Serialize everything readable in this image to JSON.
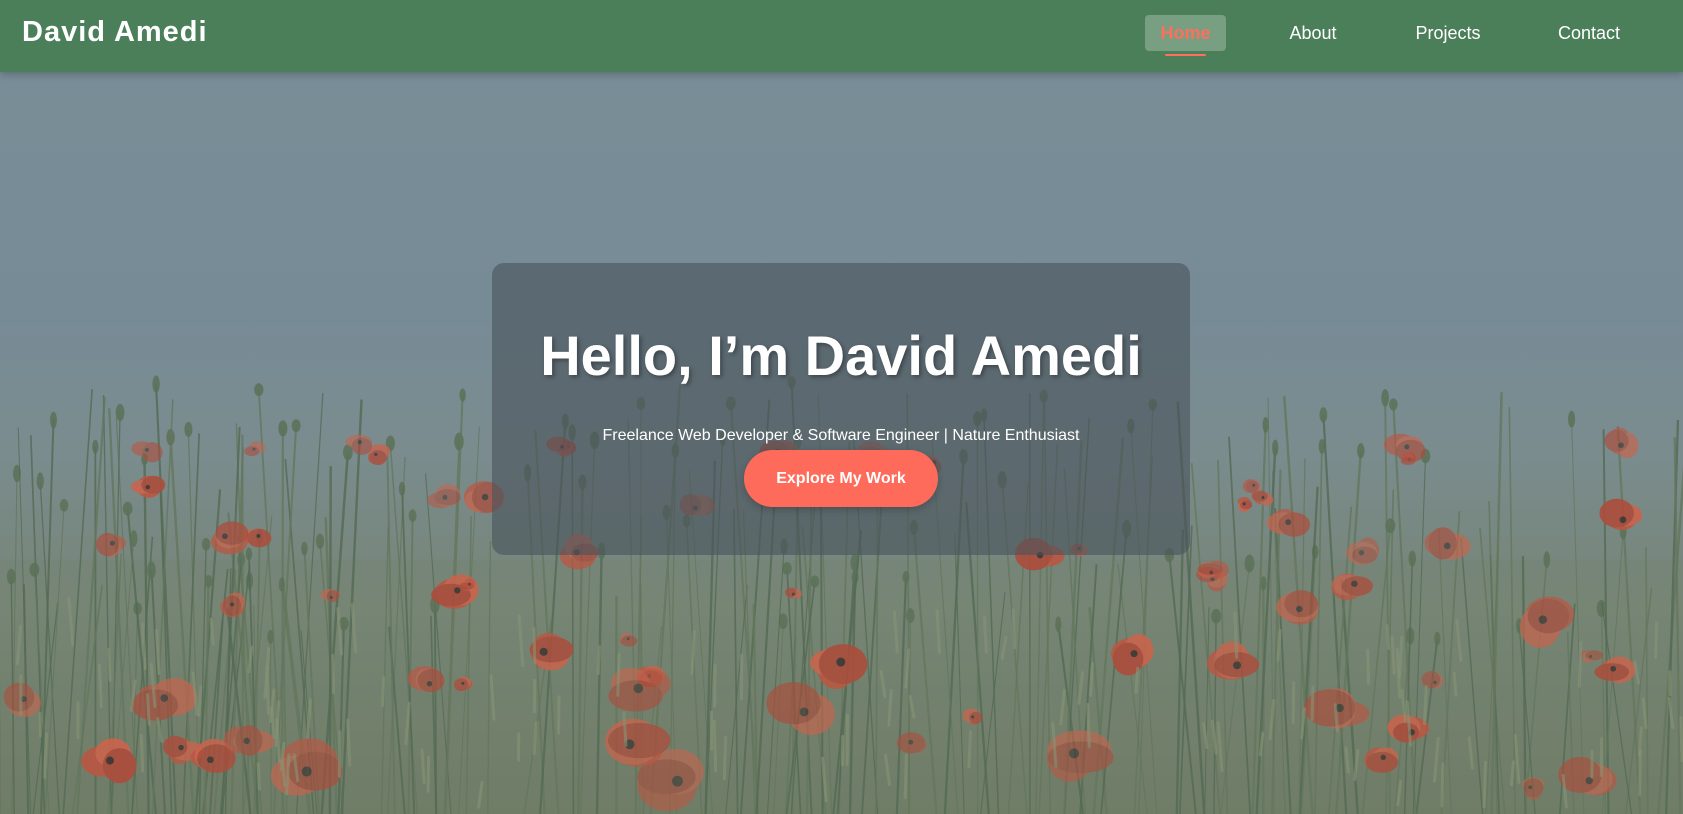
{
  "header": {
    "brand": "David Amedi",
    "nav": [
      {
        "label": "Home",
        "active": true
      },
      {
        "label": "About",
        "active": false
      },
      {
        "label": "Projects",
        "active": false
      },
      {
        "label": "Contact",
        "active": false
      }
    ]
  },
  "hero": {
    "title": "Hello, I’m David Amedi",
    "subtitle": "Freelance Web Developer & Software Engineer | Nature Enthusiast",
    "cta_label": "Explore My Work"
  },
  "colors": {
    "navbar": "#4b7f59",
    "accent": "#ff6b5b",
    "active_link": "#ff6f5e"
  }
}
